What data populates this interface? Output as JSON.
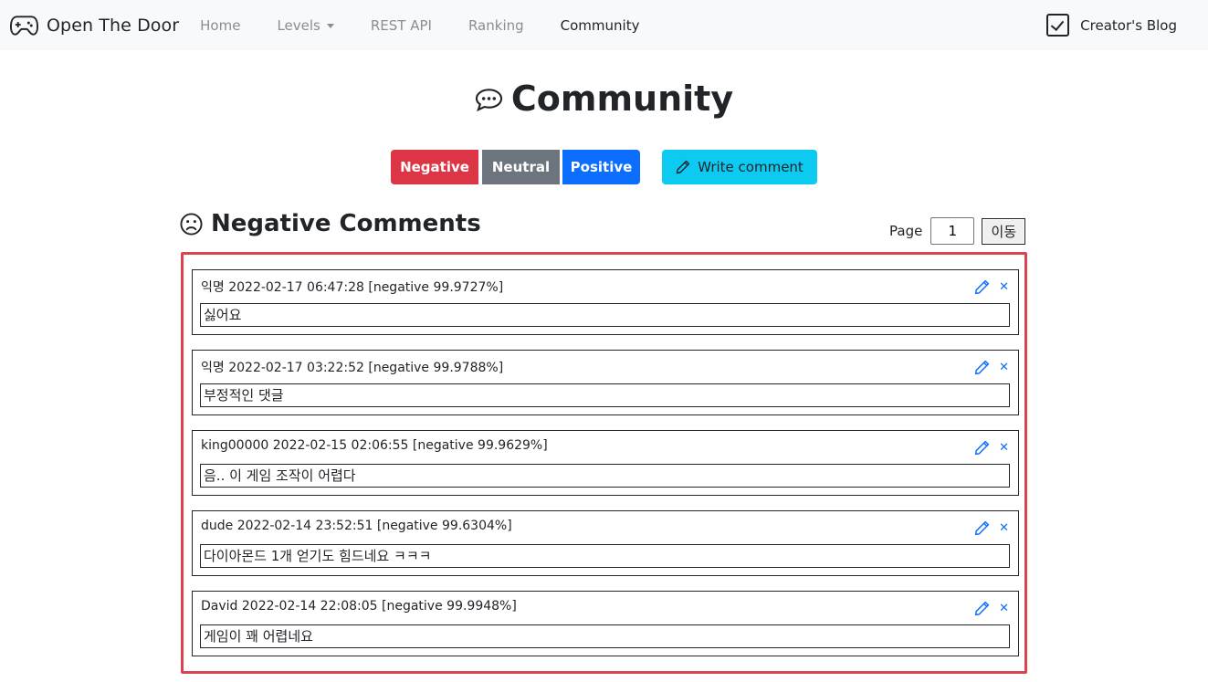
{
  "nav": {
    "brand": "Open The Door",
    "brand_icon": "gamepad-icon",
    "links": [
      "Home",
      "Levels",
      "REST API",
      "Ranking",
      "Community"
    ],
    "blog": "Creator's Blog",
    "blog_icon": "check-square-icon"
  },
  "page": {
    "title": "Community",
    "title_icon": "chat-bubble-icon"
  },
  "filters": {
    "negative": "Negative",
    "neutral": "Neutral",
    "positive": "Positive",
    "write": "Write comment"
  },
  "section": {
    "title": "Negative Comments",
    "icon": "sad-face-icon",
    "page_label": "Page",
    "page_value": "1",
    "go_label": "이동"
  },
  "comments": [
    {
      "author": "익명",
      "meta": "2022-02-17 06:47:28 [negative 99.9727%]",
      "text": "싫어요"
    },
    {
      "author": "익명",
      "meta": "2022-02-17 03:22:52 [negative 99.9788%]",
      "text": "부정적인 댓글"
    },
    {
      "author": "king00000",
      "meta": "2022-02-15 02:06:55 [negative 99.9629%]",
      "text": "음.. 이 게임 조작이 어렵다"
    },
    {
      "author": "dude",
      "meta": "2022-02-14 23:52:51 [negative 99.6304%]",
      "text": "다이아몬드 1개 얻기도 힘드네요 ㅋㅋㅋ"
    },
    {
      "author": "David",
      "meta": "2022-02-14 22:08:05 [negative 99.9948%]",
      "text": "게임이 꽤 어렵네요"
    }
  ],
  "colors": {
    "negative": "#dc3545",
    "neutral": "#6c757d",
    "positive": "#0d6efd",
    "write": "#0dcaf0",
    "list_border": "#d94450"
  }
}
